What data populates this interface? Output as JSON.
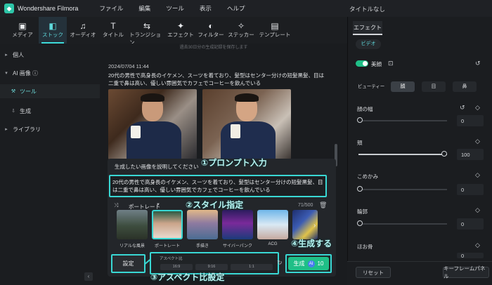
{
  "app": {
    "name": "Wondershare Filmora",
    "doc_title": "タイトルなし"
  },
  "menu": [
    "ファイル",
    "編集",
    "ツール",
    "表示",
    "ヘルプ"
  ],
  "toolbar": [
    {
      "label": "メディア",
      "icon": "media-icon"
    },
    {
      "label": "ストック",
      "icon": "stock-icon",
      "active": true
    },
    {
      "label": "オーディオ",
      "icon": "audio-icon"
    },
    {
      "label": "タイトル",
      "icon": "title-icon"
    },
    {
      "label": "トランジション",
      "icon": "transition-icon"
    },
    {
      "label": "エフェクト",
      "icon": "effect-icon"
    },
    {
      "label": "フィルター",
      "icon": "filter-icon"
    },
    {
      "label": "ステッカー",
      "icon": "sticker-icon"
    },
    {
      "label": "テンプレート",
      "icon": "template-icon"
    }
  ],
  "sidebar": {
    "items": [
      {
        "label": "個人"
      },
      {
        "label": "AI 画像 ⓘ"
      },
      {
        "label": "ツール",
        "active": true
      },
      {
        "label": "生成"
      },
      {
        "label": "ライブラリ"
      }
    ]
  },
  "feed": {
    "top_note": "過去30日分の生成記録を保存します",
    "timestamp": "2024/07/04 11:44",
    "prompt_text": "20代の男性で高身長のイケメン、スーツを着ており、髪型はセンター分けの短髪黒髪、目は二重で鼻は高い、優しい雰囲気でカフェでコーヒーを飲んでいる"
  },
  "prompt": {
    "heading": "生成したい画像を説明してください",
    "text": "20代の男性で高身長のイケメン、スーツを着ており、髪型はセンター分けの短髪黒髪、目は二重で鼻は高い、優しい雰囲気でカフェでコーヒーを飲んでいる",
    "style_selected": "ポートレート",
    "char_count": "71/500",
    "styles": [
      "リアルな風景",
      "ポートレート",
      "手描き",
      "サイバーパンク",
      "ACG"
    ],
    "settings_label": "設定",
    "aspect_label": "アスペクト比",
    "aspect_options": [
      "16:9",
      "9:16",
      "1:1"
    ],
    "generate_label": "生成",
    "generate_cost": "10"
  },
  "annotations": {
    "a1": "①プロンプト入力",
    "a2": "②スタイル指定",
    "a3": "③アスペクト比設定",
    "a4": "④生成する"
  },
  "right": {
    "tab": "エフェクト",
    "subtab": "ビデオ",
    "beauty_label": "美顔",
    "segments": [
      "ビューティー",
      "顔",
      "目",
      "鼻"
    ],
    "params": [
      {
        "label": "顔の幅",
        "value": "0"
      },
      {
        "label": "頬",
        "value": "100"
      },
      {
        "label": "こめかみ",
        "value": "0"
      },
      {
        "label": "輪郭",
        "value": "0"
      },
      {
        "label": "ほお骨",
        "value": "0"
      }
    ],
    "reset_label": "リセット",
    "keyframe_label": "キーフレームパネル"
  },
  "colors": {
    "accent": "#3ddbd9",
    "highlight": "#39d8d4",
    "bg": "#151719"
  }
}
